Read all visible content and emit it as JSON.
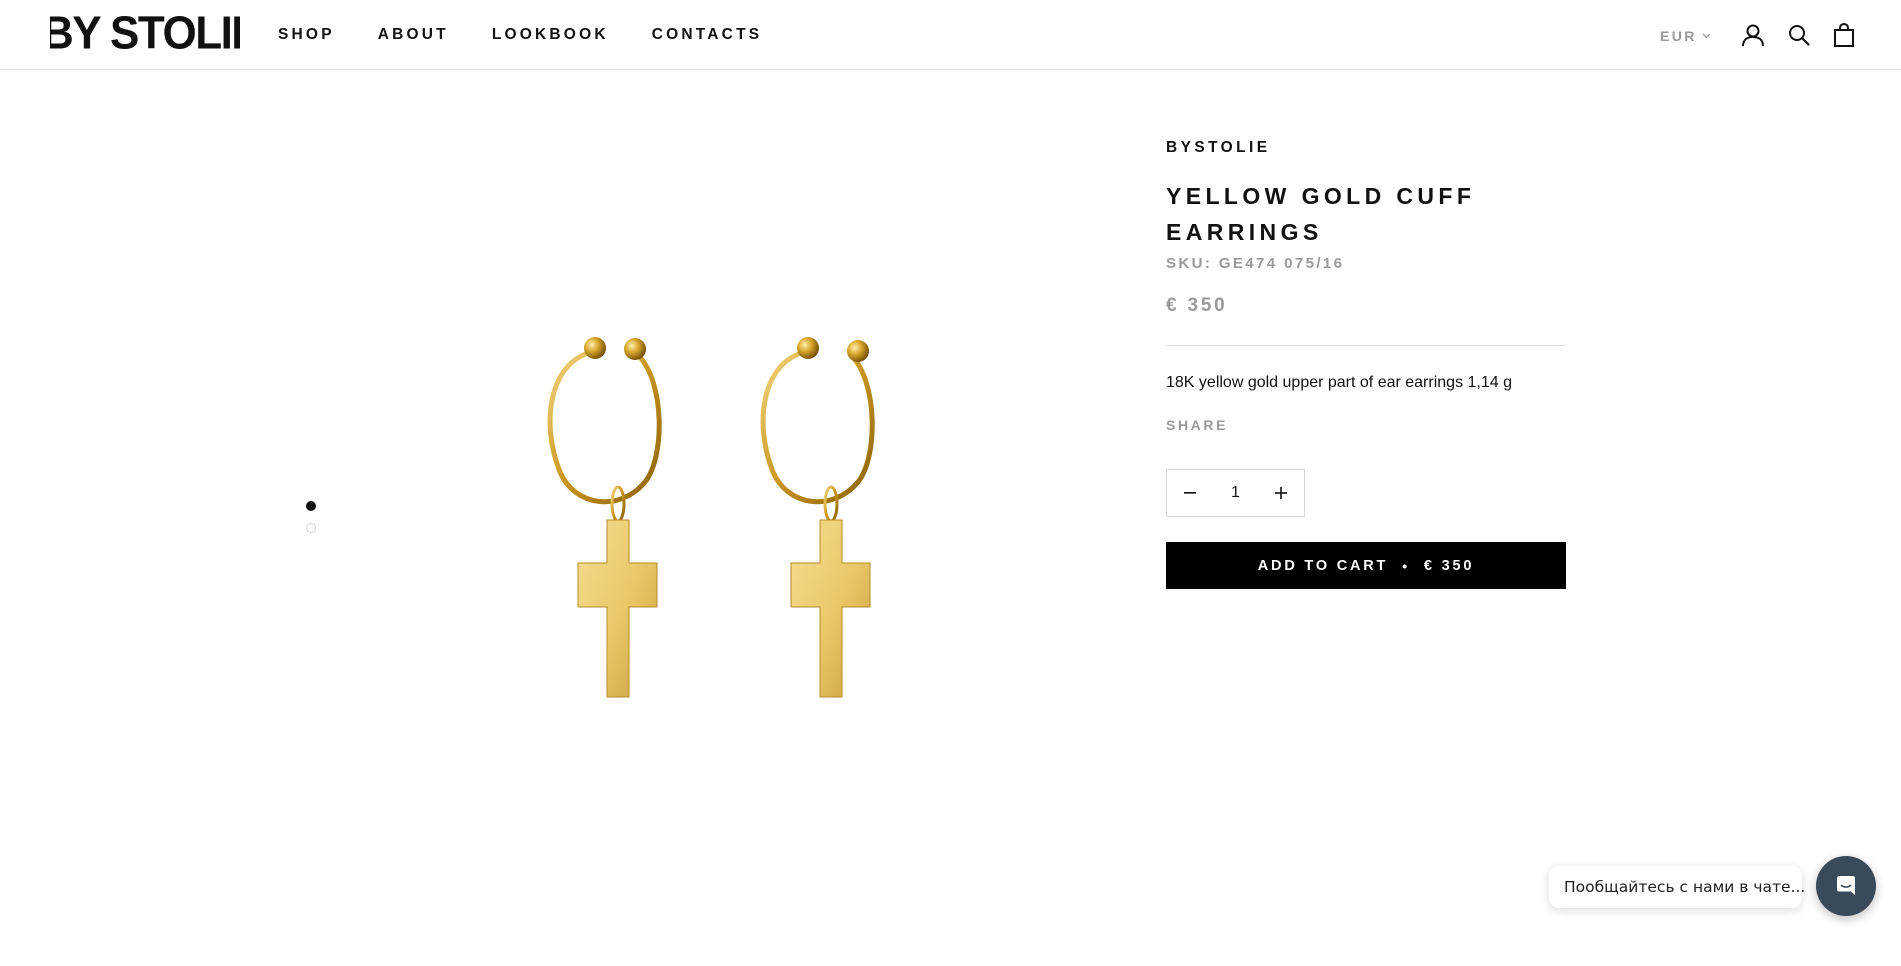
{
  "header": {
    "logo_text": "BY STOLIE",
    "nav": [
      {
        "label": "SHOP"
      },
      {
        "label": "ABOUT"
      },
      {
        "label": "LOOKBOOK"
      },
      {
        "label": "CONTACTS"
      }
    ],
    "currency": "EUR",
    "icons": [
      "account-icon",
      "search-icon",
      "cart-icon"
    ]
  },
  "gallery": {
    "slides_count": 2,
    "active_slide": 1,
    "image_alt_colors": {
      "gold": "#d4a52a",
      "gold_light": "#f0d483",
      "gold_dark": "#a77a12"
    }
  },
  "product": {
    "vendor": "BYSTOLIE",
    "title": "YELLOW GOLD CUFF EARRINGS",
    "sku": "SKU: GE474 075/16",
    "price": "€ 350",
    "description": "18K yellow gold upper part of ear earrings 1,14 g",
    "share_label": "SHARE",
    "quantity": "1",
    "add_to_cart_label": "ADD TO CART",
    "add_to_cart_separator": "•",
    "add_to_cart_price": "€ 350"
  },
  "chat": {
    "bubble_text": "Пообщайтесь с нами в чате...",
    "launcher_color": "#3b4a5a"
  }
}
